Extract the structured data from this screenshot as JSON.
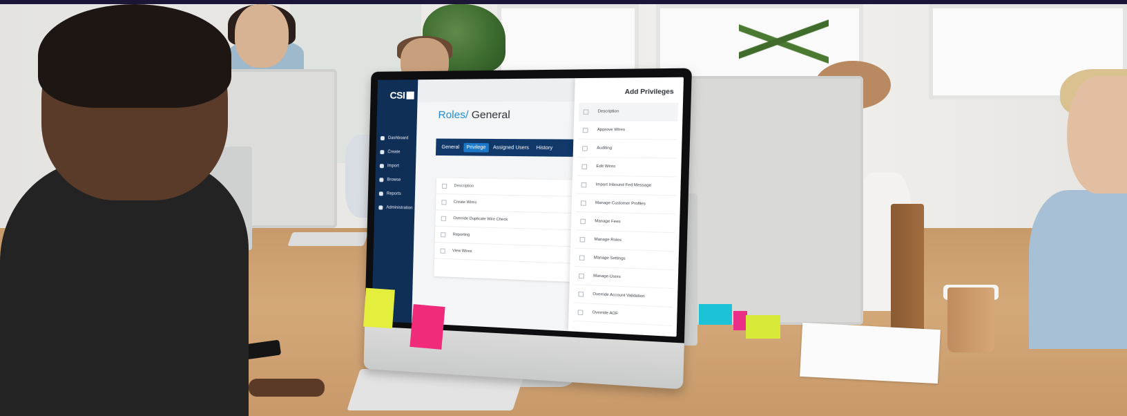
{
  "app": {
    "logo_text": "CSI",
    "page_title_prefix": "Roles/",
    "page_title": "General"
  },
  "sidebar": {
    "items": [
      {
        "label": "Dashboard",
        "icon": "home-icon"
      },
      {
        "label": "Create",
        "icon": "arrow-icon"
      },
      {
        "label": "Import",
        "icon": "document-icon"
      },
      {
        "label": "Browse",
        "icon": "search-icon"
      },
      {
        "label": "Reports",
        "icon": "report-icon"
      },
      {
        "label": "Administration",
        "icon": "admin-icon",
        "caret": "⌄"
      }
    ]
  },
  "tabs": [
    {
      "label": "General",
      "active": false
    },
    {
      "label": "Privilege",
      "active": true
    },
    {
      "label": "Assigned Users",
      "active": false
    },
    {
      "label": "History",
      "active": false
    }
  ],
  "privilege_table": {
    "header": "Description",
    "rows": [
      "Create Wires",
      "Override Duplicate Wire Check",
      "Reporting",
      "View Wires"
    ]
  },
  "add_privileges": {
    "title": "Add Privileges",
    "header": "Description",
    "rows": [
      "Approve Wires",
      "Auditing",
      "Edit Wires",
      "Import Inbound Fed Message",
      "Manage Customer Profiles",
      "Manage Fees",
      "Manage Roles",
      "Manage Settings",
      "Manage Users",
      "Override Account Validation",
      "Override AOF"
    ]
  },
  "colors": {
    "sidebar": "#0f2f57",
    "tabs_bar": "#10396a",
    "active_tab": "#1b78c8",
    "accent": "#1d8ad0"
  }
}
